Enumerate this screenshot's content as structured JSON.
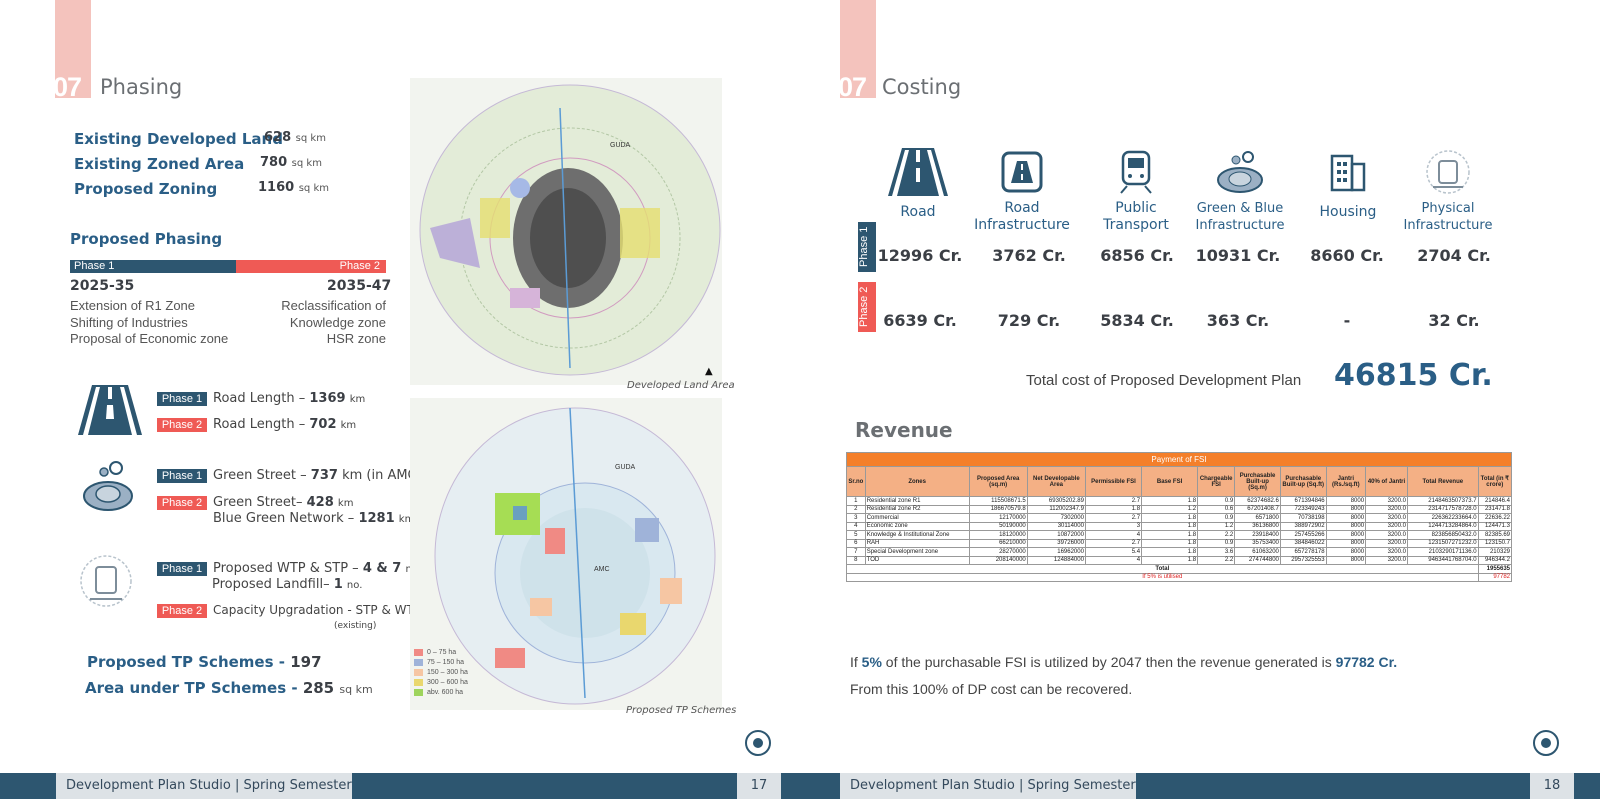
{
  "footer": {
    "studio": "Development Plan Studio | Spring Semester",
    "left_page": "17",
    "right_page": "18"
  },
  "left": {
    "section_number": "07",
    "section_title": "Phasing",
    "stats": [
      {
        "label": "Existing Developed Land",
        "value": "628",
        "unit": "sq km"
      },
      {
        "label": "Existing Zoned Area",
        "value": "780",
        "unit": "sq km"
      },
      {
        "label": "Proposed Zoning",
        "value": "1160",
        "unit": "sq km"
      }
    ],
    "phasing_title": "Proposed Phasing",
    "phase1_label": "Phase 1",
    "phase2_label": "Phase 2",
    "phase1_years": "2025-35",
    "phase2_years": "2035-47",
    "phase1_items": [
      "Extension of R1 Zone",
      "Shifting of Industries",
      "Proposal of Economic zone"
    ],
    "phase2_items": [
      "Reclassification of",
      "Knowledge zone",
      "HSR zone"
    ],
    "road": {
      "p1_text": "Road Length – ",
      "p1_value": "1369",
      "p2_text": "Road Length – ",
      "p2_value": "702",
      "unit": "km"
    },
    "green": {
      "p1_text": "Green Street – ",
      "p1_value": "737",
      "p1_suffix": "km (in AMC)",
      "p2_text": "Green Street– ",
      "p2_value": "428",
      "p2_unit": "km",
      "p2b_text": "Blue Green Network – ",
      "p2b_value": "1281",
      "p2b_unit": "km"
    },
    "infra": {
      "p1_text": "Proposed WTP & STP – ",
      "p1_value": "4 & 7",
      "p1_unit": "nos.",
      "p1b_text": "Proposed Landfill– ",
      "p1b_value": "1",
      "p1b_unit": "no.",
      "p2_text": "Capacity Upgradation - STP & WTP",
      "p2_sub": "(existing)"
    },
    "tp_schemes_label": "Proposed TP Schemes - ",
    "tp_schemes_value": "197",
    "tp_area_label": "Area under TP Schemes - ",
    "tp_area_value": "285",
    "tp_area_unit": "sq km",
    "map1_caption": "Developed Land Area",
    "map2_caption": "Proposed TP Schemes",
    "map_labels": {
      "guda": "GUDA",
      "amc": "AMC"
    },
    "legend": [
      "0 – 75 ha",
      "75 – 150 ha",
      "150 – 300 ha",
      "300 – 600 ha",
      "abv. 600 ha"
    ],
    "legend_colors": [
      "#f08a84",
      "#9fb3d9",
      "#f6c6a3",
      "#e9d76e",
      "#9ed45c"
    ]
  },
  "right": {
    "section_number": "07",
    "section_title": "Costing",
    "categories": [
      {
        "name1": "",
        "name2": "Road",
        "icon": "road-icon",
        "p1": "12996 Cr.",
        "p2": "6639 Cr."
      },
      {
        "name1": "Road",
        "name2": "Infrastructure",
        "icon": "road-infrastructure-icon",
        "p1": "3762 Cr.",
        "p2": "729 Cr."
      },
      {
        "name1": "Public",
        "name2": "Transport",
        "icon": "train-icon",
        "p1": "6856 Cr.",
        "p2": "5834 Cr."
      },
      {
        "name1": "Green & Blue",
        "name2": "Infrastructure",
        "icon": "green-blue-icon",
        "p1": "10931 Cr.",
        "p2": "363 Cr."
      },
      {
        "name1": "",
        "name2": "Housing",
        "icon": "building-icon",
        "p1": "8660 Cr.",
        "p2": "-"
      },
      {
        "name1": "Physical",
        "name2": "Infrastructure",
        "icon": "physical-infrastructure-icon",
        "p1": "2704 Cr.",
        "p2": "32 Cr."
      }
    ],
    "phase1_label": "Phase 1",
    "phase2_label": "Phase 2",
    "total_label": "Total cost of Proposed Development Plan",
    "total_value": "46815 Cr.",
    "revenue_title": "Revenue",
    "table_title": "Payment of FSI",
    "table_headers": [
      "Sr.no",
      "Zones",
      "Proposed Area (sq.m)",
      "Net Developable Area",
      "Permissible FSI",
      "Base FSI",
      "Chargeable FSI",
      "Purchasable Built-up (Sq.m)",
      "Purchasable Built-up (Sq.ft)",
      "Jantri (Rs./sq.ft)",
      "40% of Jantri",
      "Total Revenue",
      "Total (in ₹ crore)"
    ],
    "table_rows": [
      [
        "1",
        "Residential zone R1",
        "115508671.5",
        "69305202.89",
        "2.7",
        "1.8",
        "0.9",
        "62374682.6",
        "671394846",
        "8000",
        "3200.0",
        "2148463507373.7",
        "214846.4"
      ],
      [
        "2",
        "Residential zone R2",
        "186670579.8",
        "112002347.9",
        "1.8",
        "1.2",
        "0.6",
        "67201408.7",
        "723349243",
        "8000",
        "3200.0",
        "2314717578728.0",
        "231471.8"
      ],
      [
        "3",
        "Commercial",
        "12170000",
        "7302000",
        "2.7",
        "1.8",
        "0.9",
        "6571800",
        "70738198",
        "8000",
        "3200.0",
        "226362233664.0",
        "22636.22"
      ],
      [
        "4",
        "Economic zone",
        "50190000",
        "30114000",
        "3",
        "1.8",
        "1.2",
        "36136800",
        "388972902",
        "8000",
        "3200.0",
        "1244713284864.0",
        "124471.3"
      ],
      [
        "5",
        "Knowledge & Institutional Zone",
        "18120000",
        "10872000",
        "4",
        "1.8",
        "2.2",
        "23918400",
        "257455266",
        "8000",
        "3200.0",
        "823856850432.0",
        "82385.69"
      ],
      [
        "6",
        "RAH",
        "66210000",
        "39726000",
        "2.7",
        "1.8",
        "0.9",
        "35753400",
        "384846022",
        "8000",
        "3200.0",
        "1231507271232.0",
        "123150.7"
      ],
      [
        "7",
        "Special Development zone",
        "28270000",
        "16962000",
        "5.4",
        "1.8",
        "3.6",
        "61063200",
        "657278178",
        "8000",
        "3200.0",
        "2103290171136.0",
        "210329"
      ],
      [
        "8",
        "TOD",
        "208140000",
        "124884000",
        "4",
        "1.8",
        "2.2",
        "274744800",
        "2957325553",
        "8000",
        "3200.0",
        "9463441768704.0",
        "946344.2"
      ]
    ],
    "table_total_label": "Total",
    "table_total_value": "1955635",
    "table_util_label": "If 5% is utilised",
    "table_util_value": "97782",
    "note1_pre": "If ",
    "note1_pct": "5%",
    "note1_mid": " of the purchasable FSI is utilized by 2047 then the revenue generated is ",
    "note1_val": "97782 Cr.",
    "note2": "From this 100% of DP cost can be recovered."
  }
}
